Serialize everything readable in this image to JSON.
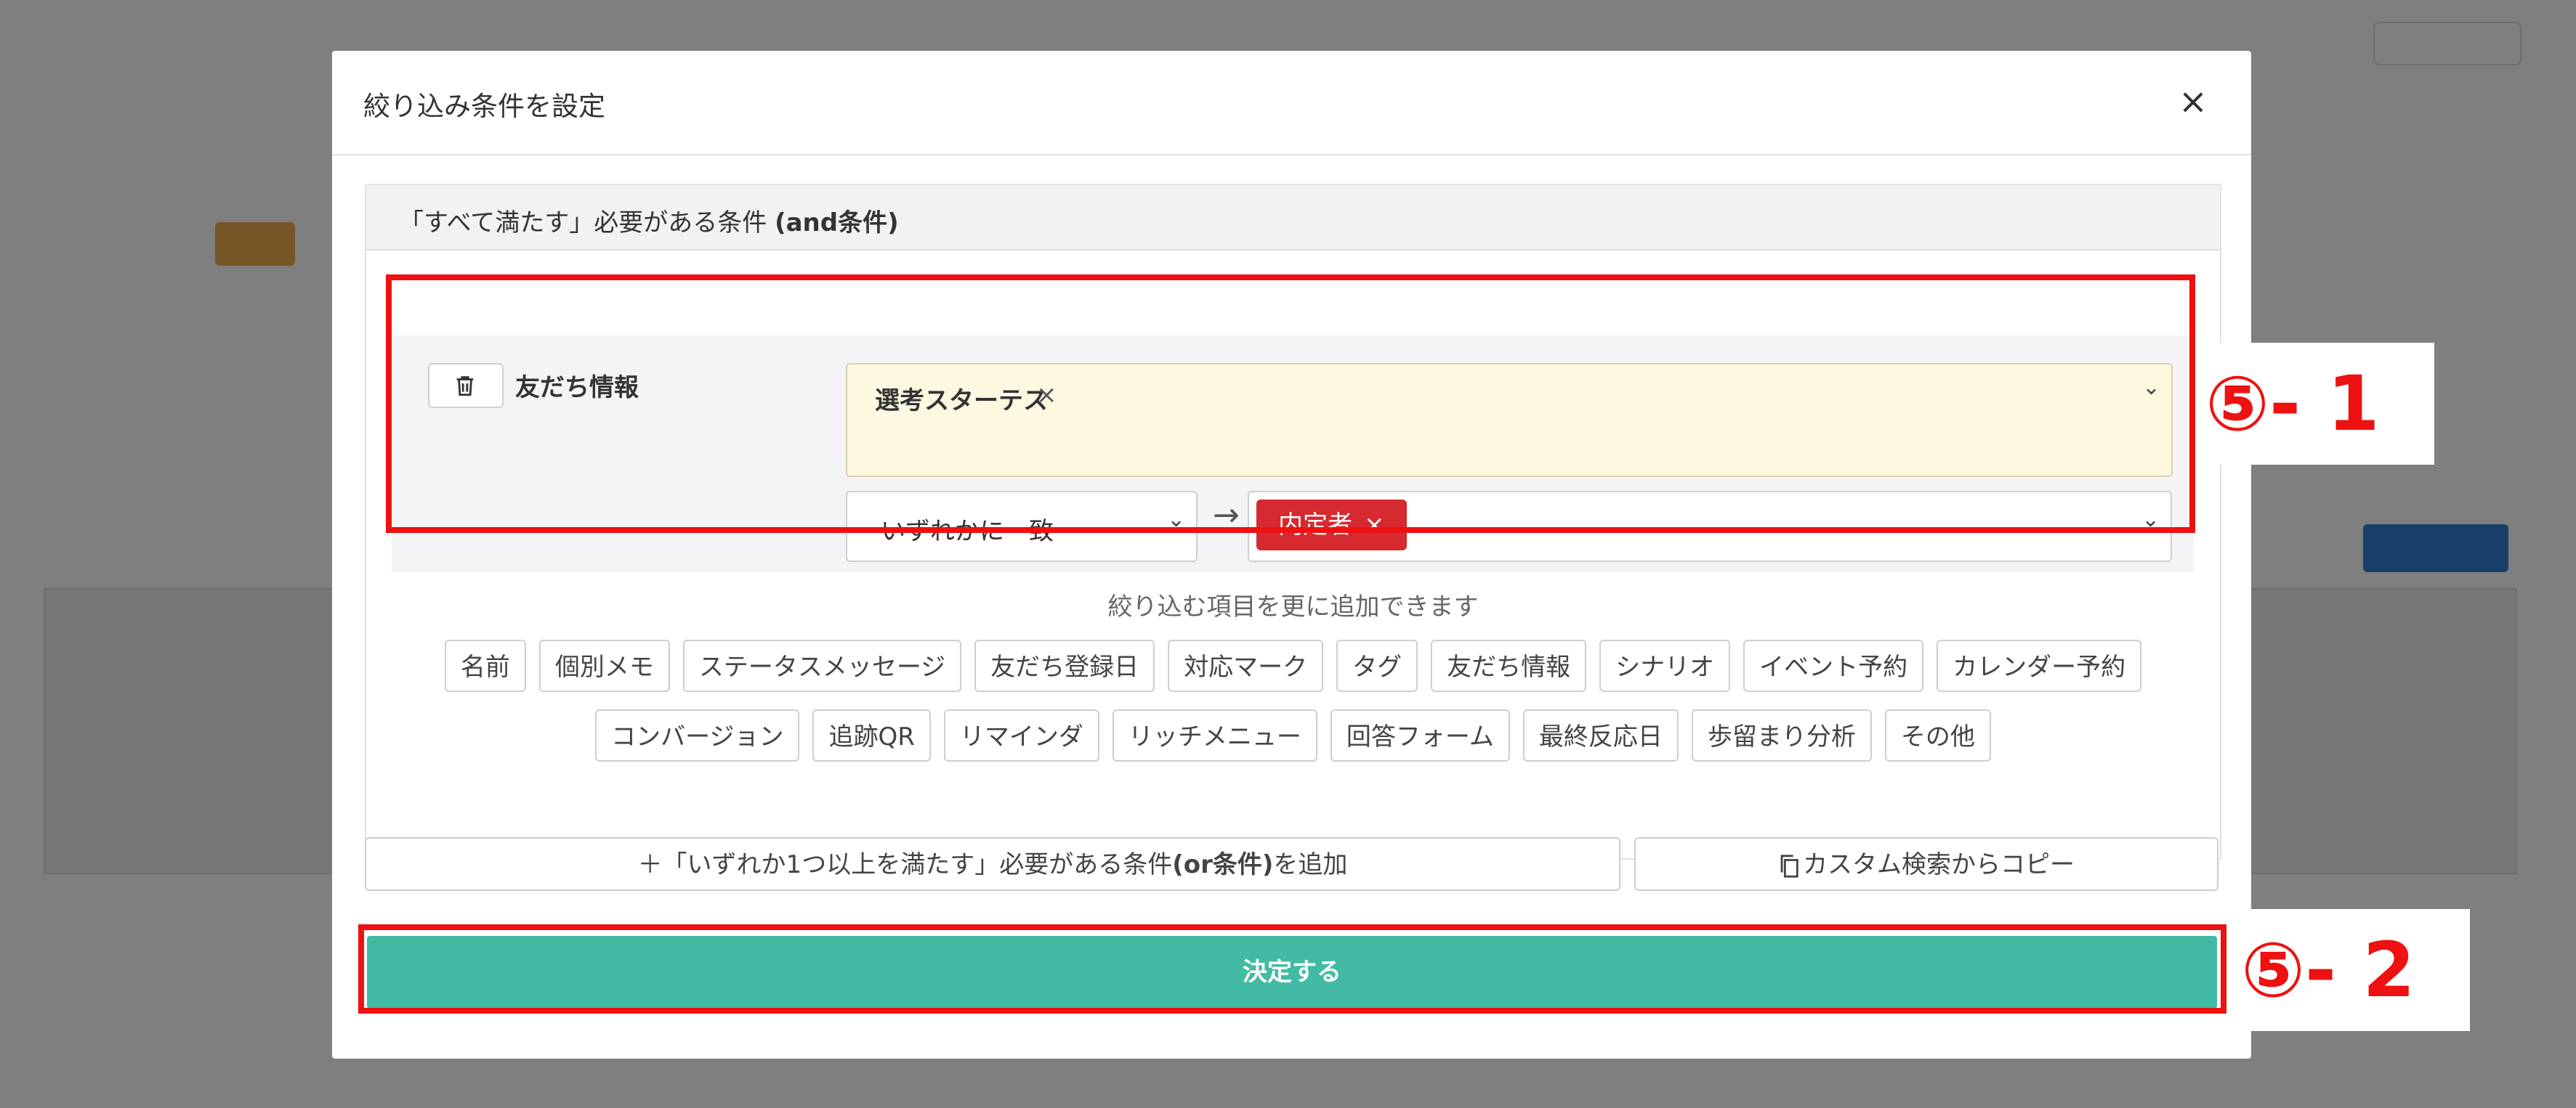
{
  "modal": {
    "title": "絞り込み条件を設定",
    "close_glyph": "×",
    "group_title_prefix": "「すべて満たす」必要がある条件",
    "group_title_bold": "(and条件)",
    "condition": {
      "label": "友だち情報",
      "field_tag": "選考スターテス",
      "field_tag_remove": "×",
      "match_mode": "いずれかに一致",
      "arrow": "→",
      "value_chip": "内定者",
      "value_chip_remove": "×"
    },
    "hint": "絞り込む項目を更に追加できます",
    "filter_chips_row1": [
      "名前",
      "個別メモ",
      "ステータスメッセージ",
      "友だち登録日",
      "対応マーク",
      "タグ",
      "友だち情報",
      "シナリオ",
      "イベント予約",
      "カレンダー予約"
    ],
    "filter_chips_row2": [
      "コンバージョン",
      "追跡QR",
      "リマインダ",
      "リッチメニュー",
      "回答フォーム",
      "最終反応日",
      "歩留まり分析",
      "その他"
    ],
    "or_button_prefix": "＋「いずれか1つ以上を満たす」必要がある条件",
    "or_button_bold": "(or条件)",
    "or_button_suffix": "を追加",
    "copy_button": "カスタム検索からコピー",
    "submit_button": "決定する"
  },
  "annotations": {
    "callout_1": "⑤- 1",
    "callout_2": "⑤- 2",
    "color": "#ee1111"
  },
  "colors": {
    "submit": "#43bba4",
    "value_chip": "#d62930",
    "tag_field_bg": "#fdf8e0"
  }
}
